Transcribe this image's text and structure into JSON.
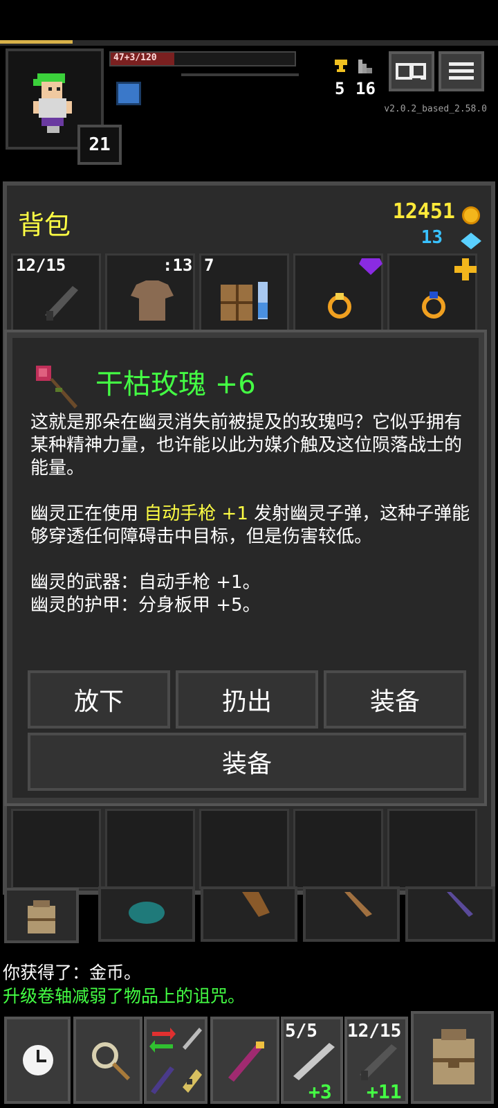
{
  "hud": {
    "hp_text": "47+3/120",
    "level": "21",
    "iron_keys": "5",
    "depth": "16",
    "version": "v2.0.2_based_2.58.0"
  },
  "backpack": {
    "title": "背包",
    "gold": "12451",
    "gems": "13",
    "slots": [
      {
        "label": "12/15",
        "icon": "gun-icon"
      },
      {
        "label": ":13",
        "icon": "cloth-armor-icon"
      },
      {
        "label": "7",
        "icon": "chest-icon"
      },
      {
        "label": "",
        "icon": "amber-ring-icon"
      },
      {
        "label": "",
        "icon": "sapphire-ring-icon"
      }
    ]
  },
  "item": {
    "name": "干枯玫瑰 +6",
    "desc1": "这就是那朵在幽灵消失前被提及的玫瑰吗？它似乎拥有某种精神力量，也许能以此为媒介触及这位陨落战士的能量。",
    "desc2_pre": "幽灵正在使用",
    "desc2_hl": "自动手枪 +1",
    "desc2_post": "发射幽灵子弹，这种子弹能够穿透任何障碍击中目标，但是伤害较低。",
    "weapon_line": "幽灵的武器：自动手枪 +1。",
    "armor_line": "幽灵的护甲：分身板甲 +5。",
    "buttons": {
      "drop": "放下",
      "throw": "扔出",
      "equip1": "装备",
      "equip2": "装备"
    }
  },
  "log": {
    "line1": "你获得了：金币。",
    "line2": "升级卷轴减弱了物品上的诅咒。"
  },
  "toolbar": {
    "qs1_count": "5/5",
    "qs1_bonus": "+3",
    "qs2_count": "12/15",
    "qs2_bonus": "+11"
  },
  "colors": {
    "accent_yellow": "#ffff44",
    "item_name_green": "#44ff44",
    "gem_blue": "#39c2ff"
  }
}
